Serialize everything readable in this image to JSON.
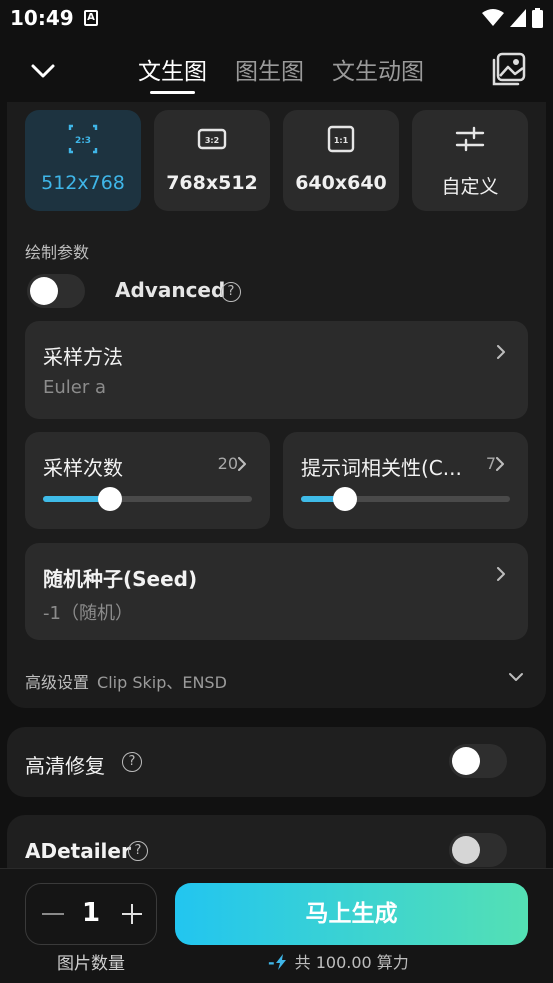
{
  "status_bar": {
    "time": "10:49",
    "notif_letter": "A"
  },
  "header": {
    "tabs": [
      {
        "label": "文生图",
        "active": true
      },
      {
        "label": "图生图",
        "active": false
      },
      {
        "label": "文生动图",
        "active": false
      }
    ]
  },
  "sizes": [
    {
      "ratio": "2:3",
      "label": "512x768",
      "active": true
    },
    {
      "ratio": "3:2",
      "label": "768x512",
      "active": false
    },
    {
      "ratio": "1:1",
      "label": "640x640",
      "active": false
    },
    {
      "ratio": "",
      "label": "自定义",
      "active": false
    }
  ],
  "params": {
    "section_label": "绘制参数",
    "advanced_label": "Advanced",
    "advanced_on": false,
    "help_glyph": "?"
  },
  "sampler": {
    "title": "采样方法",
    "value": "Euler a"
  },
  "steps": {
    "title": "采样次数",
    "value": "20",
    "fraction": 0.32
  },
  "cfg": {
    "title": "提示词相关性(C...",
    "value": "7",
    "fraction": 0.21
  },
  "seed": {
    "title": "随机种子(Seed)",
    "value": "-1（随机）"
  },
  "advanced_settings": {
    "label": "高级设置",
    "detail": "Clip Skip、ENSD"
  },
  "hires": {
    "title": "高清修复",
    "enabled": false
  },
  "adetailer": {
    "title": "ADetailer",
    "enabled": false
  },
  "bottom": {
    "quantity": "1",
    "quantity_label": "图片数量",
    "generate_label": "马上生成",
    "cost_dash": "-",
    "cost_text": "共 100.00 算力"
  },
  "colors": {
    "accent": "#3fb6e8",
    "gradient_start": "#22c5f0",
    "gradient_end": "#54e0b4"
  }
}
